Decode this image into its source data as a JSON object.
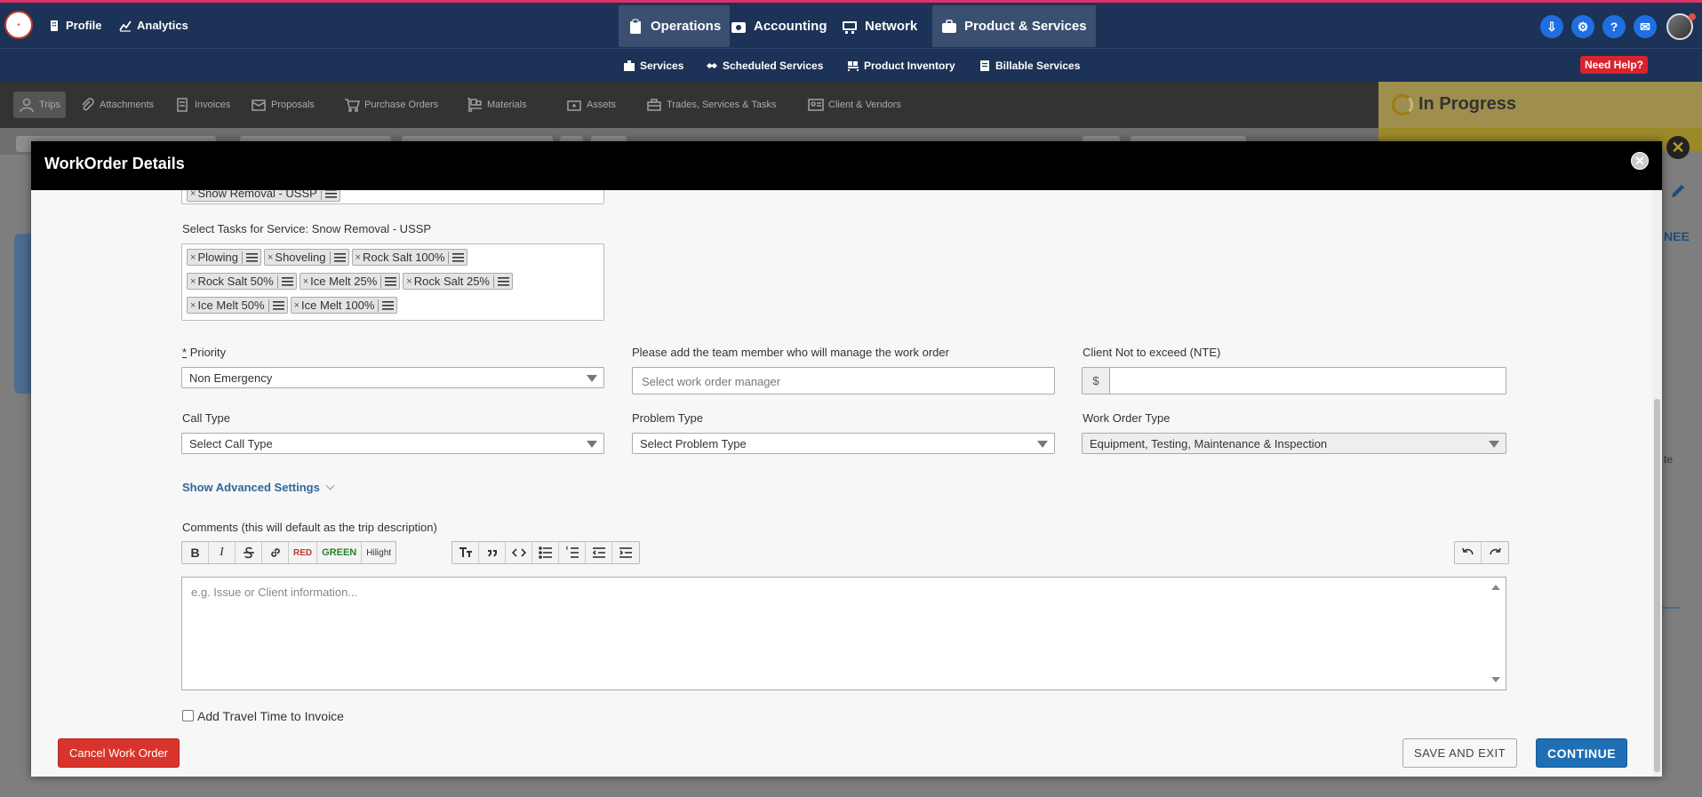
{
  "topnav": {
    "profile": "Profile",
    "analytics": "Analytics",
    "main": [
      "Operations",
      "Accounting",
      "Network",
      "Product & Services"
    ]
  },
  "subnav": {
    "items": [
      "Services",
      "Scheduled Services",
      "Product Inventory",
      "Billable Services"
    ],
    "need_help": "Need Help?"
  },
  "tabs": [
    "Trips",
    "Attachments",
    "Invoices",
    "Proposals",
    "Purchase Orders",
    "Materials",
    "Assets",
    "Trades, Services & Tasks",
    "Client & Vendors"
  ],
  "status": {
    "label": "In Progress"
  },
  "side_fragments": {
    "nee": "NEE",
    "te": "te"
  },
  "modal": {
    "title": "WorkOrder Details",
    "service_tag": "Snow Removal - USSP",
    "tasks_label": "Select Tasks for Service: Snow Removal - USSP",
    "tasks": [
      [
        "Plowing",
        "Shoveling",
        "Rock Salt 100%"
      ],
      [
        "Rock Salt 50%",
        "Ice Melt 25%",
        "Rock Salt 25%"
      ],
      [
        "Ice Melt 50%",
        "Ice Melt 100%"
      ]
    ],
    "priority": {
      "required_mark": "*",
      "label": "Priority",
      "value": "Non Emergency"
    },
    "manager": {
      "label": "Please add the team member who will manage the work order",
      "placeholder": "Select work order manager"
    },
    "nte": {
      "label": "Client Not to exceed (NTE)",
      "currency": "$",
      "value": ""
    },
    "call_type": {
      "label": "Call Type",
      "value": "Select Call Type"
    },
    "problem_type": {
      "label": "Problem Type",
      "value": "Select Problem Type"
    },
    "work_order_type": {
      "label": "Work Order Type",
      "value": "Equipment, Testing, Maintenance & Inspection"
    },
    "advanced": "Show Advanced Settings",
    "comments": {
      "label": "Comments (this will default as the trip description)",
      "placeholder": "e.g. Issue or Client information...",
      "toolbar": {
        "bold": "B",
        "italic": "I",
        "red": "RED",
        "green": "GREEN",
        "hilight": "Hilight"
      }
    },
    "travel_time": {
      "label": "Add Travel Time to Invoice",
      "checked": false
    },
    "footer": {
      "cancel": "Cancel Work Order",
      "save_exit": "SAVE AND EXIT",
      "continue": "CONTINUE"
    }
  },
  "colors": {
    "nav_bg": "#1c3256",
    "accent_blue": "#1f6fb5",
    "danger": "#d9342b",
    "status_bg": "#9e8f4e"
  }
}
